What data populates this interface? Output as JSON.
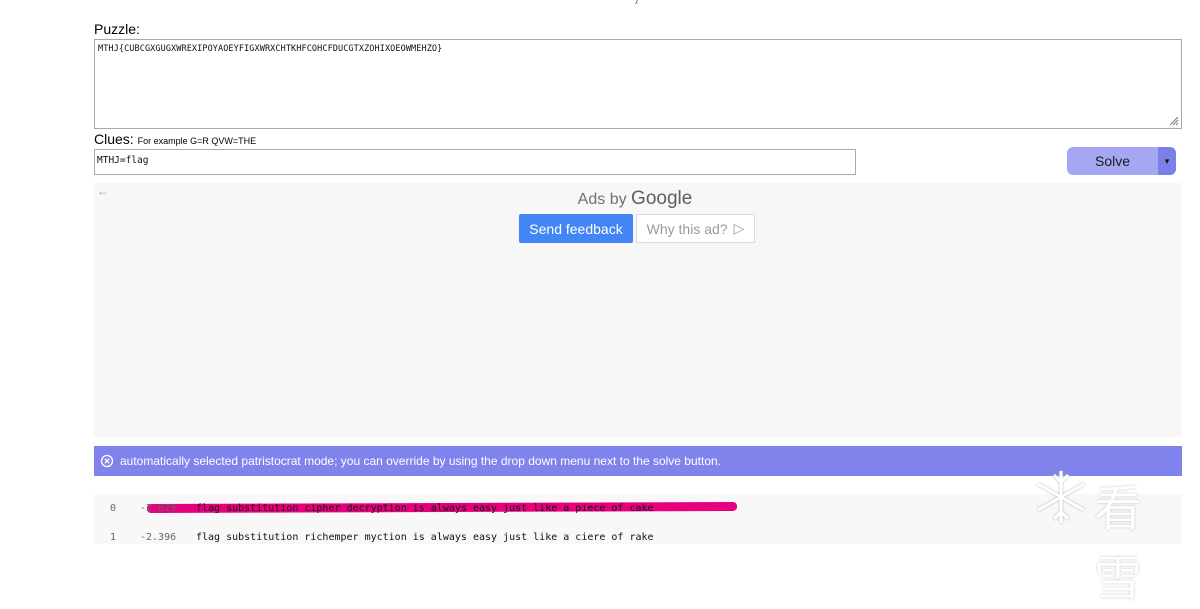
{
  "puzzle": {
    "label": "Puzzle:",
    "value": "MTHJ{CUBCGXGUGXWREXIPOYAOEYFIGXWRXCHTKHFCOHCFDUCGTXZOHIXOEOWMEHZO}"
  },
  "clues": {
    "label": "Clues:",
    "example": "For example G=R QVW=THE",
    "value": "MTHJ=flag"
  },
  "solve": {
    "label": "Solve",
    "caret": "▾"
  },
  "ad": {
    "back": "←",
    "ads_by": "Ads by",
    "google": "Google",
    "send_feedback": "Send feedback",
    "why_this_ad": "Why this ad?",
    "why_icon": "▷"
  },
  "notice": {
    "icon": "circle-x-icon",
    "text": "automatically selected patristocrat mode; you can override by using the drop down menu next to the solve button."
  },
  "results": [
    {
      "index": "0",
      "score": "-2.029",
      "text": "flag substitution cipher decryption is always easy just like a piece of cake"
    },
    {
      "index": "1",
      "score": "-2.396",
      "text": "flag substitution richemper myction is always easy just like a ciere of rake"
    }
  ],
  "watermark": {
    "text": "看雪"
  },
  "colors": {
    "solve_button": "#a5a7f2",
    "solve_caret": "#7b7fe8",
    "notice_bg": "#8183ec",
    "feedback_blue": "#4285f4",
    "highlight": "#e6007e"
  }
}
